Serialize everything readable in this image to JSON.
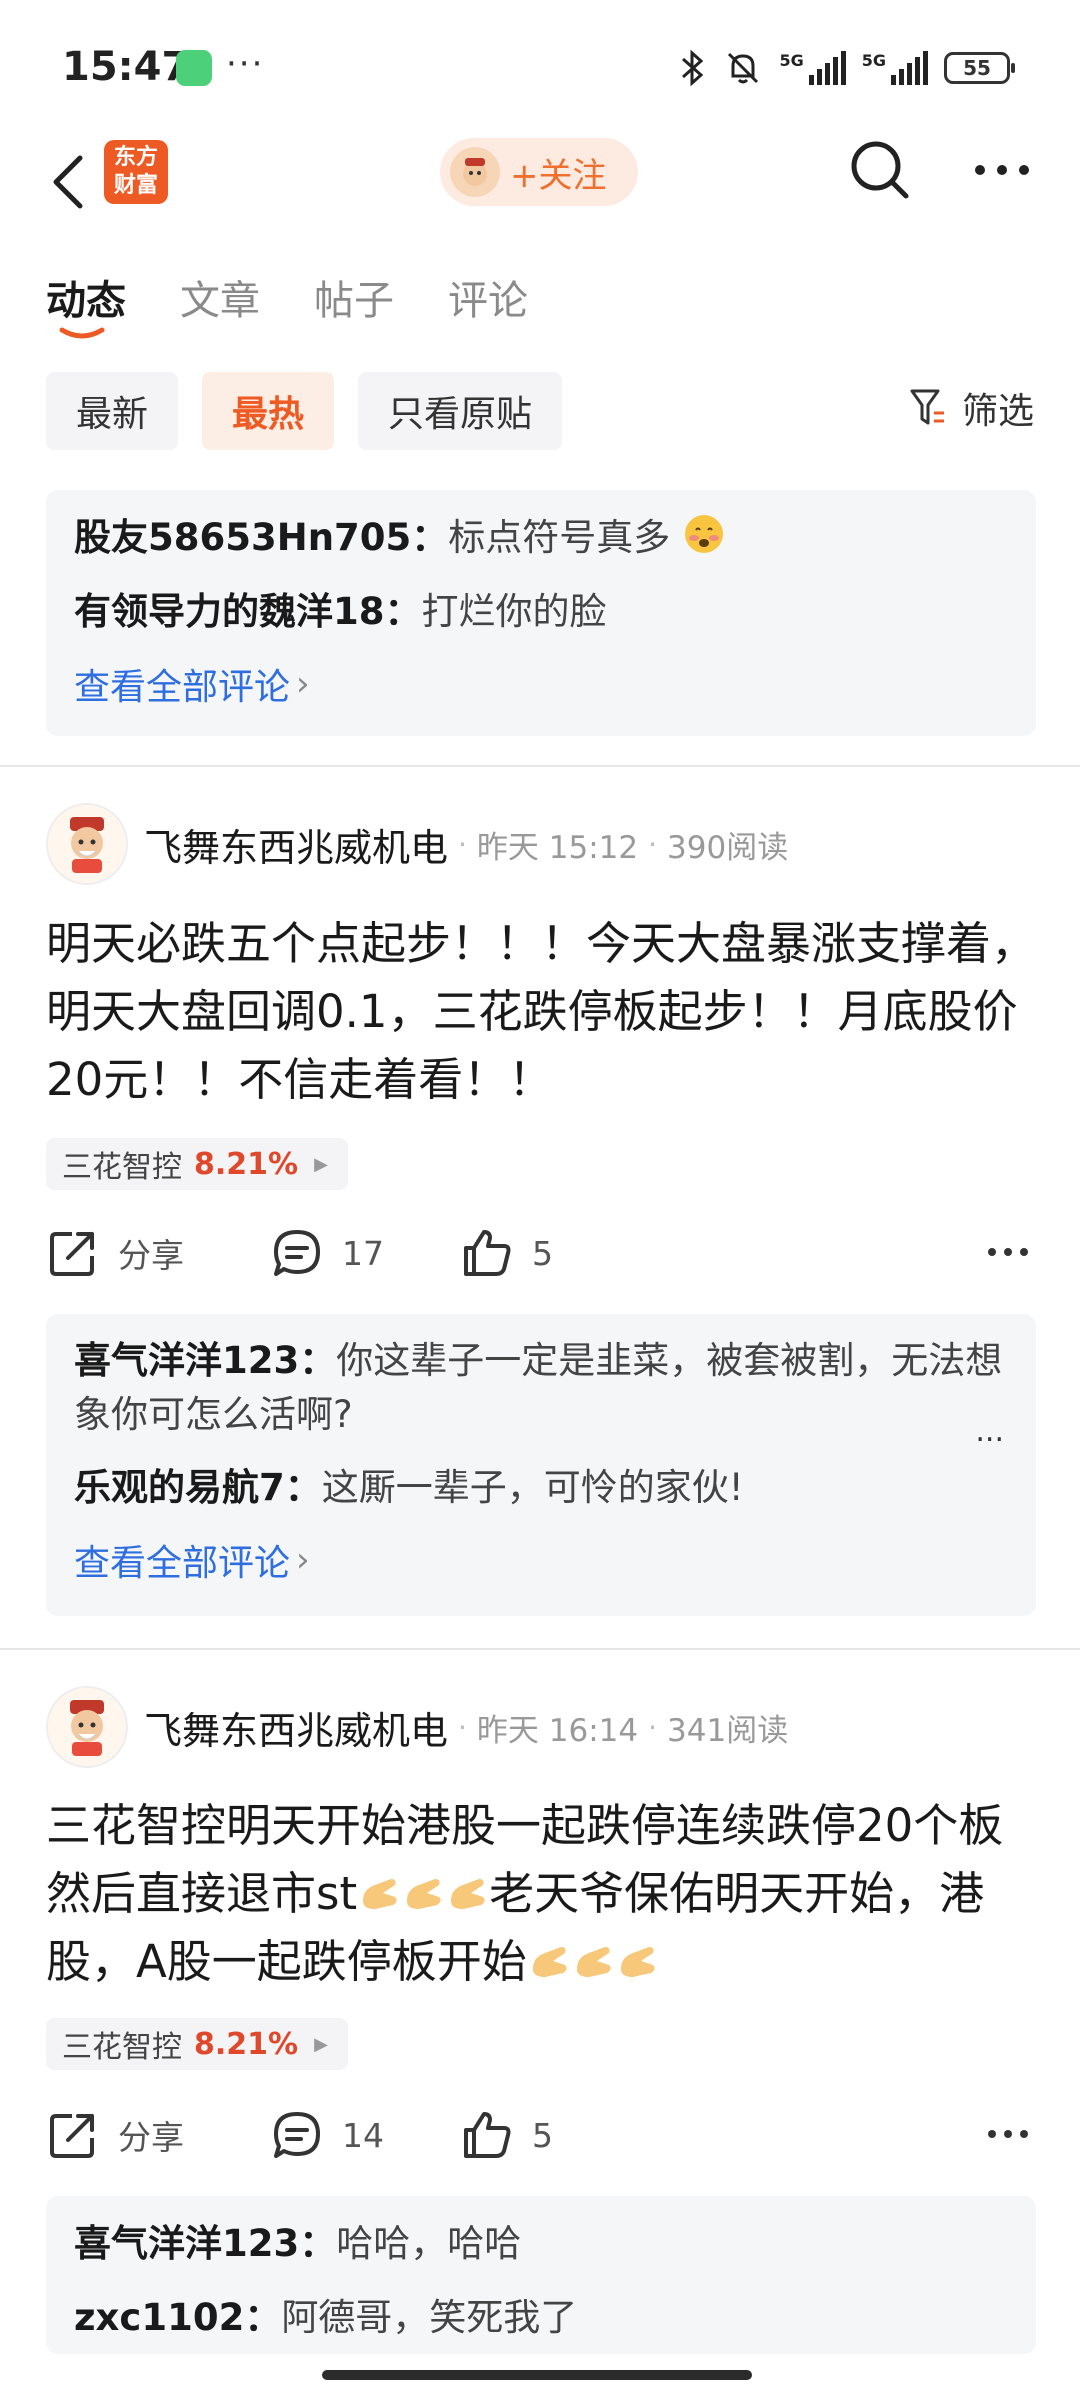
{
  "status_bar": {
    "time": "15:47",
    "dots": "···",
    "network_1": "5G",
    "network_2": "5G",
    "battery": "55",
    "icons": [
      "app-shield-icon",
      "bluetooth-icon",
      "mute-icon",
      "signal-icon",
      "battery-icon"
    ]
  },
  "header": {
    "logo_text_1": "东方",
    "logo_text_2": "财富",
    "follow_label": "+关注",
    "icons": [
      "back-icon",
      "search-icon",
      "more-icon"
    ]
  },
  "tabs": [
    "动态",
    "文章",
    "帖子",
    "评论"
  ],
  "filters": {
    "chips": [
      "最新",
      "最热",
      "只看原贴"
    ],
    "filter_label": "筛选"
  },
  "top_comments": {
    "items": [
      {
        "name": "股友58653Hn705",
        "text": "标点符号真多"
      },
      {
        "name": "有领导力的魏洋18",
        "text": "打烂你的脸"
      }
    ],
    "see_all": "查看全部评论"
  },
  "posts": [
    {
      "author": "飞舞东西兆威机电",
      "time": "昨天 15:12",
      "reads": "390阅读",
      "body": "明天必跌五个点起步！！！今天大盘暴涨支撑着，明天大盘回调0.1，三花跌停板起步！！月底股价20元！！不信走着看！！",
      "stock_name": "三花智控",
      "stock_change": "8.21%",
      "share_label": "分享",
      "comment_count": "17",
      "like_count": "5",
      "comments": [
        {
          "name": "喜气洋洋123",
          "text": "你这辈子一定是韭菜，被套被割，无法想象你可怎么活啊?"
        },
        {
          "name": "乐观的易航7",
          "text": "这厮一辈子，可怜的家伙!"
        }
      ],
      "more": "...",
      "see_all": "查看全部评论"
    },
    {
      "author": "飞舞东西兆威机电",
      "time": "昨天 16:14",
      "reads": "341阅读",
      "body_1": "三花智控明天开始港股一起跌停连续跌停20个板然后直接退市st",
      "body_2": "老天爷保佑明天开始，港股，A股一起跌停板开始",
      "stock_name": "三花智控",
      "stock_change": "8.21%",
      "share_label": "分享",
      "comment_count": "14",
      "like_count": "5",
      "comments": [
        {
          "name": "喜气洋洋123",
          "text": "哈哈，哈哈"
        },
        {
          "name": "zxc1102",
          "text": "阿德哥，笑死我了"
        }
      ]
    }
  ],
  "colors": {
    "accent": "#ee5a24",
    "link": "#2e6ee0",
    "stock_up": "#e0482c",
    "box_bg": "#f5f6f8"
  }
}
